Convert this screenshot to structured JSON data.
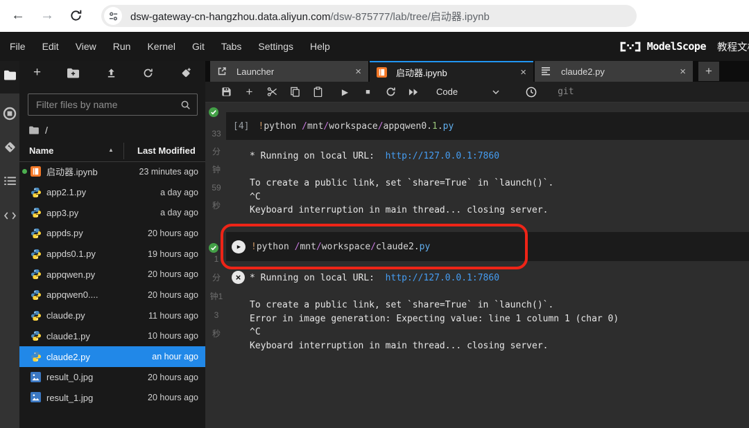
{
  "browser": {
    "url_domain": "dsw-gateway-cn-hangzhou.data.aliyun.com",
    "url_path": "/dsw-875777/lab/tree/启动器.ipynb"
  },
  "menubar": {
    "items": [
      "File",
      "Edit",
      "View",
      "Run",
      "Kernel",
      "Git",
      "Tabs",
      "Settings",
      "Help"
    ],
    "brand": "ModelScope",
    "docs_link": "教程文档"
  },
  "sidebar_icons": [
    "file-browser",
    "running-sessions",
    "git",
    "table-of-contents",
    "code-snippets"
  ],
  "filebrowser": {
    "filter_placeholder": "Filter files by name",
    "breadcrumb_root": "/",
    "columns": {
      "name": "Name",
      "modified": "Last Modified"
    },
    "files": [
      {
        "name": "启动器.ipynb",
        "modified": "23 minutes ago",
        "type": "notebook",
        "running": true,
        "selected": false
      },
      {
        "name": "app2.1.py",
        "modified": "a day ago",
        "type": "python",
        "running": false,
        "selected": false
      },
      {
        "name": "app3.py",
        "modified": "a day ago",
        "type": "python",
        "running": false,
        "selected": false
      },
      {
        "name": "appds.py",
        "modified": "20 hours ago",
        "type": "python",
        "running": false,
        "selected": false
      },
      {
        "name": "appds0.1.py",
        "modified": "19 hours ago",
        "type": "python",
        "running": false,
        "selected": false
      },
      {
        "name": "appqwen.py",
        "modified": "20 hours ago",
        "type": "python",
        "running": false,
        "selected": false
      },
      {
        "name": "appqwen0....",
        "modified": "20 hours ago",
        "type": "python",
        "running": false,
        "selected": false
      },
      {
        "name": "claude.py",
        "modified": "11 hours ago",
        "type": "python",
        "running": false,
        "selected": false
      },
      {
        "name": "claude1.py",
        "modified": "10 hours ago",
        "type": "python",
        "running": false,
        "selected": false
      },
      {
        "name": "claude2.py",
        "modified": "an hour ago",
        "type": "python",
        "running": false,
        "selected": true
      },
      {
        "name": "result_0.jpg",
        "modified": "20 hours ago",
        "type": "image",
        "running": false,
        "selected": false
      },
      {
        "name": "result_1.jpg",
        "modified": "20 hours ago",
        "type": "image",
        "running": false,
        "selected": false
      }
    ]
  },
  "tabs": [
    {
      "label": "Launcher",
      "icon": "launcher",
      "active": false
    },
    {
      "label": "启动器.ipynb",
      "icon": "notebook",
      "active": true
    },
    {
      "label": "claude2.py",
      "icon": "text-file",
      "active": false
    }
  ],
  "toolbar": {
    "cell_type": "Code",
    "git_label": "git"
  },
  "cells": [
    {
      "status": "success",
      "exec_time": "33分钟59秒",
      "exec_time_lines": [
        "33",
        "分",
        "钟",
        "59",
        "秒"
      ],
      "prompt": "[4]",
      "code_tokens": [
        {
          "t": "!",
          "c": "bang"
        },
        {
          "t": "python ",
          "c": "plain"
        },
        {
          "t": "/",
          "c": "op"
        },
        {
          "t": "mnt",
          "c": "plain"
        },
        {
          "t": "/",
          "c": "op"
        },
        {
          "t": "workspace",
          "c": "plain"
        },
        {
          "t": "/",
          "c": "op"
        },
        {
          "t": "appqwen0",
          "c": "plain"
        },
        {
          "t": ".",
          "c": "plain"
        },
        {
          "t": "1",
          "c": "num"
        },
        {
          "t": ".",
          "c": "plain"
        },
        {
          "t": "py",
          "c": "prop"
        }
      ],
      "output_lines": [
        {
          "segs": [
            {
              "t": "* Running on local URL:  "
            },
            {
              "t": "http://127.0.0.1:7860",
              "c": "link"
            }
          ]
        },
        {
          "segs": []
        },
        {
          "segs": [
            {
              "t": "To create a public link, set `share=True` in `launch()`."
            }
          ]
        },
        {
          "segs": [
            {
              "t": "^C"
            }
          ]
        },
        {
          "segs": [
            {
              "t": "Keyboard interruption in main thread... closing server."
            }
          ]
        }
      ]
    },
    {
      "status": "success",
      "exec_time": "1分钟13秒",
      "exec_time_lines": [
        "1",
        "分",
        "钟1",
        "3",
        "秒"
      ],
      "annotated": true,
      "code_tokens": [
        {
          "t": "!",
          "c": "bang"
        },
        {
          "t": "python ",
          "c": "plain"
        },
        {
          "t": "/",
          "c": "op"
        },
        {
          "t": "mnt",
          "c": "plain"
        },
        {
          "t": "/",
          "c": "op"
        },
        {
          "t": "workspace",
          "c": "plain"
        },
        {
          "t": "/",
          "c": "op"
        },
        {
          "t": "claude2",
          "c": "plain"
        },
        {
          "t": ".",
          "c": "plain"
        },
        {
          "t": "py",
          "c": "prop"
        }
      ],
      "output_lines": [
        {
          "segs": [
            {
              "t": "* Running on local URL:  "
            },
            {
              "t": "http://127.0.0.1:7860",
              "c": "link"
            }
          ]
        },
        {
          "segs": []
        },
        {
          "segs": [
            {
              "t": "To create a public link, set `share=True` in `launch()`."
            }
          ]
        },
        {
          "segs": [
            {
              "t": "Error in image generation: Expecting value: line 1 column 1 (char 0)"
            }
          ]
        },
        {
          "segs": [
            {
              "t": "^C"
            }
          ]
        },
        {
          "segs": [
            {
              "t": "Keyboard interruption in main thread... closing server."
            }
          ]
        }
      ]
    }
  ],
  "colors": {
    "active_tab_accent": "#2196f3",
    "selected_row_blue": "#2188e8",
    "link_blue": "#459df2",
    "annotation_red": "#ee2417",
    "success_green": "#43a047",
    "notebook_orange": "#f37726",
    "code_operator": "#c678dd",
    "code_number": "#98c379",
    "code_extension": "#61afef",
    "code_bang": "#d19a66"
  }
}
